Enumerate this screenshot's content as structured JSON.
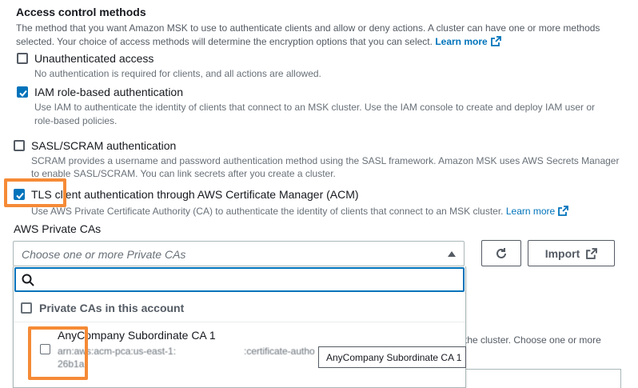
{
  "section": {
    "title": "Access control methods",
    "description": "The method that you want Amazon MSK to use to authenticate clients and allow or deny actions. A cluster can have one or more methods selected. Your choice of access methods will determine the encryption options that you can select.",
    "learn_more": "Learn more"
  },
  "options": [
    {
      "label": "Unauthenticated access",
      "description": "No authentication is required for clients, and all actions are allowed.",
      "checked": false
    },
    {
      "label": "IAM role-based authentication",
      "description_line1": "Use IAM to authenticate the identity of clients that connect to an MSK cluster. Use the IAM console to create and deploy IAM user or",
      "description_line2": "role-based policies.",
      "checked": true
    },
    {
      "label": "SASL/SCRAM authentication",
      "description_line1": "SCRAM provides a username and password authentication method using the SASL framework. Amazon MSK uses AWS Secrets Manager",
      "description_line2": "to enable SASL/SCRAM. You can link secrets after you create a cluster.",
      "checked": false
    },
    {
      "label": "TLS client authentication through AWS Certificate Manager (ACM)",
      "description": "Use AWS Private Certificate Authority (CA) to authenticate the identity of clients that connect to an MSK cluster.",
      "learn_more": "Learn more",
      "checked": true
    }
  ],
  "private_cas": {
    "label": "AWS Private CAs",
    "placeholder": "Choose one or more Private CAs",
    "refresh_icon": "refresh-icon",
    "import_label": "Import",
    "search_value": "",
    "group_label": "Private CAs in this account",
    "items": [
      {
        "name": "AnyCompany Subordinate CA 1",
        "arn_prefix": "arn:aws:acm-pca:us-east-1:",
        "arn_suffix": ":certificate-autho",
        "arn_line2": "26b1a"
      }
    ]
  },
  "tooltip": "AnyCompany Subordinate CA 1",
  "behind_text": "the cluster. Choose one or more",
  "colors": {
    "accent": "#0073bb",
    "highlight": "#f58a36",
    "text": "#16191f",
    "muted": "#687078"
  }
}
